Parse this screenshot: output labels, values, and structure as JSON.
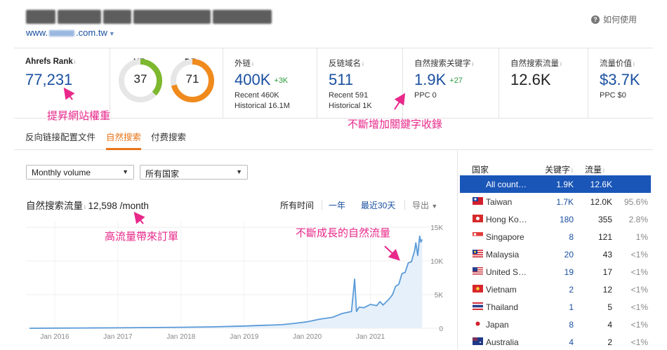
{
  "header": {
    "url_prefix": "www.",
    "url_suffix": ".com.tw",
    "help_label": "如何使用"
  },
  "metrics": {
    "ahrefs_rank": {
      "label": "Ahrefs Rank",
      "value": "77,231"
    },
    "ur": {
      "label": "UR",
      "value": "37",
      "fraction": 0.37,
      "color": "#7db82e"
    },
    "dr": {
      "label": "DR",
      "value": "71",
      "fraction": 0.71,
      "color": "#f08a1c"
    },
    "backlinks": {
      "label": "外链",
      "value": "400K",
      "delta": "+3K",
      "recent": "Recent 460K",
      "historical": "Historical 16.1M"
    },
    "ref_domains": {
      "label": "反链域名",
      "value": "511",
      "recent": "Recent 591",
      "historical": "Historical 1K"
    },
    "organic_keywords": {
      "label": "自然搜索关键字",
      "value": "1.9K",
      "delta": "+27",
      "ppc": "PPC 0"
    },
    "organic_traffic": {
      "label": "自然搜索流量",
      "value": "12.6K"
    },
    "traffic_value": {
      "label": "流量价值",
      "value": "$3.7K",
      "ppc": "PPC $0"
    }
  },
  "tabs": [
    {
      "label": "反向链接配置文件"
    },
    {
      "label": "自然搜索"
    },
    {
      "label": "付费搜索"
    }
  ],
  "controls": {
    "volume_select": "Monthly volume",
    "country_select": "所有国家"
  },
  "traffic": {
    "title": "自然搜索流量",
    "value": "12,598 /month",
    "ranges": [
      "所有时间",
      "一年",
      "最近30天"
    ],
    "export": "导出"
  },
  "annotations": {
    "rank": "提昇網站權重",
    "keywords": "不斷增加關鍵字收錄",
    "traffic": "高流量帶來訂單",
    "growth": "不斷成長的自然流量"
  },
  "chart_data": {
    "type": "area",
    "x_tick_labels": [
      "Jan 2016",
      "Jan 2017",
      "Jan 2018",
      "Jan 2019",
      "Jan 2020",
      "Jan 2021"
    ],
    "y_tick_labels": [
      "15K",
      "10K",
      "5K",
      "0"
    ],
    "ylim": [
      0,
      15000
    ],
    "xlim": [
      2015.6,
      2021.85
    ],
    "grid": true,
    "color": "#5b9bd8",
    "x": [
      2015.6,
      2016.0,
      2016.5,
      2017.0,
      2017.5,
      2018.0,
      2018.5,
      2019.0,
      2019.3,
      2019.6,
      2019.8,
      2020.0,
      2020.2,
      2020.4,
      2020.55,
      2020.7,
      2020.75,
      2020.78,
      2020.82,
      2020.9,
      2021.0,
      2021.1,
      2021.15,
      2021.2,
      2021.3,
      2021.35,
      2021.4,
      2021.45,
      2021.5,
      2021.55,
      2021.6,
      2021.65,
      2021.7,
      2021.72,
      2021.75,
      2021.78,
      2021.8,
      2021.82
    ],
    "y": [
      0,
      20,
      40,
      60,
      100,
      150,
      200,
      350,
      420,
      550,
      700,
      1000,
      1300,
      1700,
      2100,
      2600,
      7000,
      2600,
      3000,
      3200,
      3400,
      3500,
      3800,
      3600,
      4200,
      5200,
      6000,
      6800,
      7800,
      8600,
      9400,
      10200,
      11200,
      13000,
      10500,
      14000,
      12500,
      13500
    ]
  },
  "countries": {
    "headers": {
      "country": "国家",
      "keywords": "关键字",
      "traffic": "流量"
    },
    "rows": [
      {
        "name": "All count…",
        "keywords": "1.9K",
        "traffic": "12.6K",
        "pct": "",
        "flag": "none"
      },
      {
        "name": "Taiwan",
        "keywords": "1.7K",
        "traffic": "12.0K",
        "pct": "95.6%",
        "flag": "tw"
      },
      {
        "name": "Hong Ko…",
        "keywords": "180",
        "traffic": "355",
        "pct": "2.8%",
        "flag": "hk"
      },
      {
        "name": "Singapore",
        "keywords": "8",
        "traffic": "121",
        "pct": "1%",
        "flag": "sg"
      },
      {
        "name": "Malaysia",
        "keywords": "20",
        "traffic": "43",
        "pct": "<1%",
        "flag": "my"
      },
      {
        "name": "United S…",
        "keywords": "19",
        "traffic": "17",
        "pct": "<1%",
        "flag": "us"
      },
      {
        "name": "Vietnam",
        "keywords": "2",
        "traffic": "12",
        "pct": "<1%",
        "flag": "vn"
      },
      {
        "name": "Thailand",
        "keywords": "1",
        "traffic": "5",
        "pct": "<1%",
        "flag": "th"
      },
      {
        "name": "Japan",
        "keywords": "8",
        "traffic": "4",
        "pct": "<1%",
        "flag": "jp"
      },
      {
        "name": "Australia",
        "keywords": "4",
        "traffic": "2",
        "pct": "<1%",
        "flag": "au"
      }
    ]
  }
}
